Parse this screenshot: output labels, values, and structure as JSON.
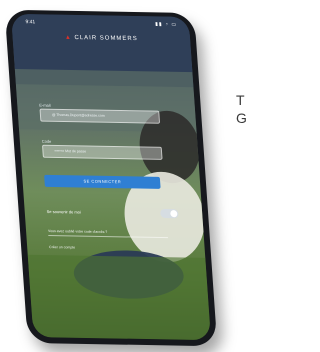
{
  "app": {
    "brand_name": "CLAIR SOMMERS",
    "status_time": "9:41",
    "status_icons": "▮▮ ◔ ▭"
  },
  "login_form": {
    "email_label": "E-mail",
    "email_placeholder": "@ Thomas.Dupont@adresse.com",
    "password_label": "Code",
    "password_placeholder": "•••••••• Mot de passe",
    "signin_label": "SE CONNECTER",
    "remember_label": "Se souvenir de moi",
    "forgot_link": "Vous avez oublié votre code d'accès ?",
    "signup_link": "Créer un compte"
  },
  "colors": {
    "accent": "#d8312a",
    "primary_button": "#2f7fd3"
  },
  "side_caption": "T\nG"
}
